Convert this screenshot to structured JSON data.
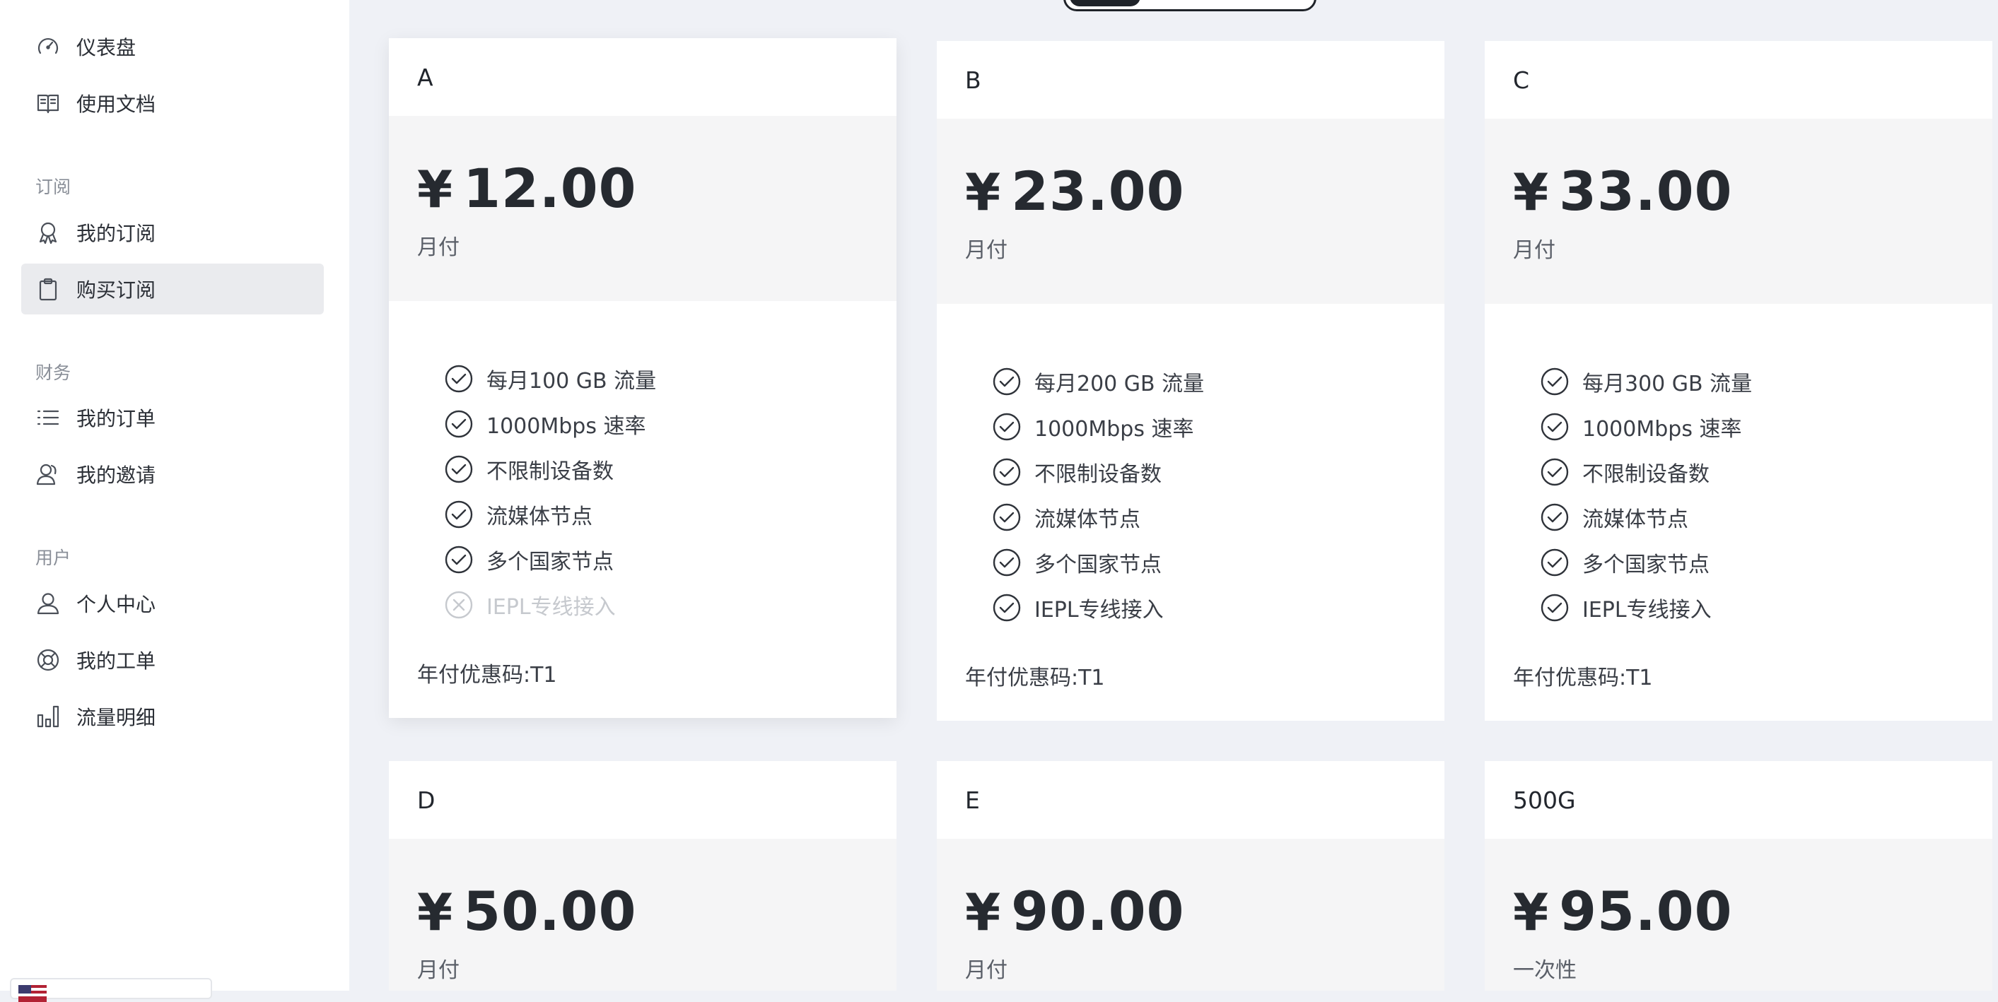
{
  "sidebar": {
    "items": [
      {
        "label": "仪表盘",
        "icon": "dashboard-icon"
      },
      {
        "label": "使用文档",
        "icon": "book-icon"
      },
      {
        "label": "我的订阅",
        "icon": "badge-icon"
      },
      {
        "label": "购买订阅",
        "icon": "clipboard-icon"
      },
      {
        "label": "我的订单",
        "icon": "list-icon"
      },
      {
        "label": "我的邀请",
        "icon": "users-icon"
      },
      {
        "label": "个人中心",
        "icon": "user-icon"
      },
      {
        "label": "我的工单",
        "icon": "lifebuoy-icon"
      },
      {
        "label": "流量明细",
        "icon": "bar-chart-icon"
      }
    ],
    "groups": [
      "订阅",
      "财务",
      "用户"
    ],
    "active_item": "购买订阅"
  },
  "plans": [
    {
      "name": "A",
      "currency": "¥",
      "price": "12.00",
      "period": "月付",
      "features": [
        {
          "text": "每月100 GB 流量",
          "ok": true
        },
        {
          "text": "1000Mbps 速率",
          "ok": true
        },
        {
          "text": "不限制设备数",
          "ok": true
        },
        {
          "text": "流媒体节点",
          "ok": true
        },
        {
          "text": "多个国家节点",
          "ok": true
        },
        {
          "text": "IEPL专线接入",
          "ok": false
        }
      ],
      "promo": "年付优惠码:T1"
    },
    {
      "name": "B",
      "currency": "¥",
      "price": "23.00",
      "period": "月付",
      "features": [
        {
          "text": "每月200 GB 流量",
          "ok": true
        },
        {
          "text": "1000Mbps 速率",
          "ok": true
        },
        {
          "text": "不限制设备数",
          "ok": true
        },
        {
          "text": "流媒体节点",
          "ok": true
        },
        {
          "text": "多个国家节点",
          "ok": true
        },
        {
          "text": "IEPL专线接入",
          "ok": true
        }
      ],
      "promo": "年付优惠码:T1"
    },
    {
      "name": "C",
      "currency": "¥",
      "price": "33.00",
      "period": "月付",
      "features": [
        {
          "text": "每月300 GB 流量",
          "ok": true
        },
        {
          "text": "1000Mbps 速率",
          "ok": true
        },
        {
          "text": "不限制设备数",
          "ok": true
        },
        {
          "text": "流媒体节点",
          "ok": true
        },
        {
          "text": "多个国家节点",
          "ok": true
        },
        {
          "text": "IEPL专线接入",
          "ok": true
        }
      ],
      "promo": "年付优惠码:T1"
    },
    {
      "name": "D",
      "currency": "¥",
      "price": "50.00",
      "period": "月付",
      "features": [],
      "promo": ""
    },
    {
      "name": "E",
      "currency": "¥",
      "price": "90.00",
      "period": "月付",
      "features": [],
      "promo": ""
    },
    {
      "name": "500G",
      "currency": "¥",
      "price": "95.00",
      "period": "一次性",
      "features": [],
      "promo": ""
    }
  ]
}
